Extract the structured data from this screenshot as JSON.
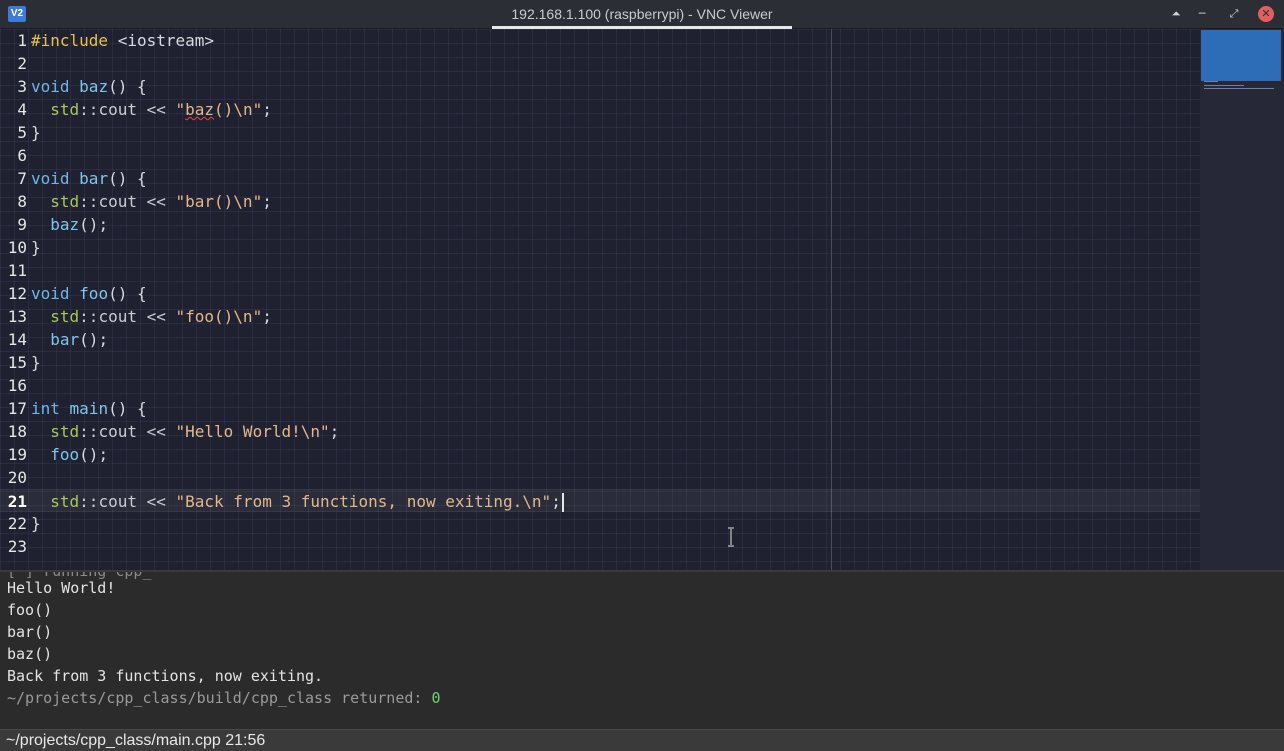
{
  "window": {
    "title": "192.168.1.100 (raspberrypi) - VNC Viewer",
    "app_icon": "V2",
    "controls": {
      "keep_above": "⏶",
      "minimize": "─",
      "restore": "⤢",
      "close": "✕"
    }
  },
  "editor": {
    "line_numbers": [
      "1",
      "2",
      "3",
      "4",
      "5",
      "6",
      "7",
      "8",
      "9",
      "10",
      "11",
      "12",
      "13",
      "14",
      "15",
      "16",
      "17",
      "18",
      "19",
      "20",
      "21",
      "22",
      "23"
    ],
    "current_line": "21",
    "code": {
      "l1_directive": "#include",
      "l1_header": " <iostream>",
      "l3_type": "void",
      "l3_name": "baz",
      "l3_rest": "() {",
      "l4_ns": "std",
      "l4_rest": "::cout << ",
      "l4_str_a": "\"",
      "l4_str_b": "baz",
      "l4_str_c": "()\\n\"",
      "l4_end": ";",
      "l5": "}",
      "l7_type": "void",
      "l7_name": "bar",
      "l7_rest": "() {",
      "l8_ns": "std",
      "l8_rest": "::cout << ",
      "l8_str": "\"bar()\\n\"",
      "l8_end": ";",
      "l9_call": "baz",
      "l9_rest": "();",
      "l10": "}",
      "l12_type": "void",
      "l12_name": "foo",
      "l12_rest": "() {",
      "l13_ns": "std",
      "l13_rest": "::cout << ",
      "l13_str": "\"foo()\\n\"",
      "l13_end": ";",
      "l14_call": "bar",
      "l14_rest": "();",
      "l15": "}",
      "l17_type": "int",
      "l17_name": "main",
      "l17_rest": "() {",
      "l18_ns": "std",
      "l18_rest": "::cout << ",
      "l18_str": "\"Hello World!\\n\"",
      "l18_end": ";",
      "l19_call": "foo",
      "l19_rest": "();",
      "l21_ns": "std",
      "l21_rest": "::cout << ",
      "l21_str": "\"Back from 3 functions, now exiting.\\n\"",
      "l21_end": ";",
      "l22": "}"
    }
  },
  "output": {
    "cut_line": "[ ] running cpp_",
    "lines": [
      "Hello World!",
      "foo()",
      "bar()",
      "baz()",
      "Back from 3 functions, now exiting."
    ],
    "return_path": "~/projects/cpp_class/build/cpp_class returned: ",
    "return_code": "0"
  },
  "status_bar": {
    "text": "~/projects/cpp_class/main.cpp 21:56"
  },
  "colors": {
    "accent": "#3d7bd9",
    "string": "#e2b88a",
    "keyword": "#6fb6e8",
    "namespace": "#a6c85a",
    "preprocessor": "#e8c34a",
    "return_code": "#6ed36e",
    "close_button": "#e06060"
  }
}
